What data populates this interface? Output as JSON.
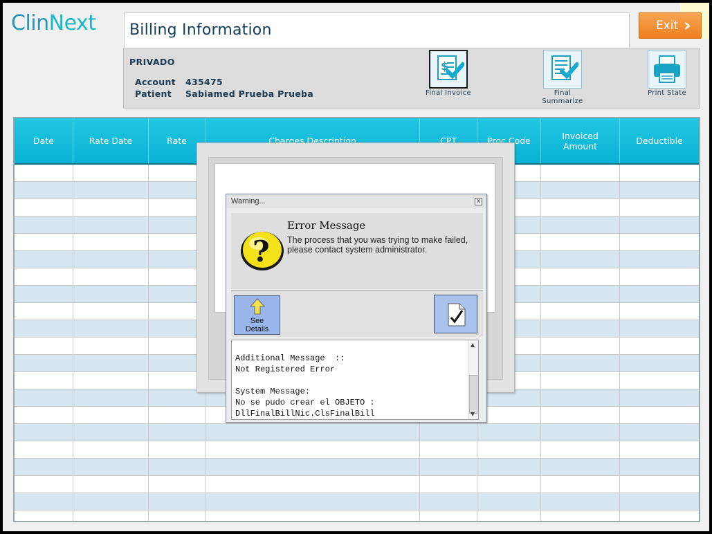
{
  "header": {
    "logo_clin": "Clin",
    "logo_next": "Next",
    "title": "Billing Information",
    "exit_label": "Exit"
  },
  "info": {
    "payer": "PRIVADO",
    "account_label": "Account",
    "account_value": "435475",
    "patient_label": "Patient",
    "patient_value": "Sabiamed Prueba Prueba"
  },
  "toolbar": {
    "final_invoice": "Final Invoice",
    "final_summarize_1": "Final",
    "final_summarize_2": "Summarize",
    "print_state": "Print State"
  },
  "grid": {
    "columns": [
      "Date",
      "Rate Date",
      "Rate",
      "Charges Description",
      "CPT",
      "Proc Code",
      "Invoiced Amount",
      "Deductible"
    ]
  },
  "warning": {
    "window_title": "Warning...",
    "close_glyph": "x",
    "error_title": "Error Message",
    "error_text": "The process that you was trying to make failed, please contact system administrator.",
    "see_details_1": "See",
    "see_details_2": "Details",
    "message": "Additional Message  ::\nNot Registered Error\n\nSystem Message:\nNo se pudo crear el OBJETO :\nDllFinalBillNic.ClsFinalBill"
  },
  "colors": {
    "accent": "#0ab3d3",
    "exit": "#f39033",
    "row_alt": "#d5e6ef"
  }
}
